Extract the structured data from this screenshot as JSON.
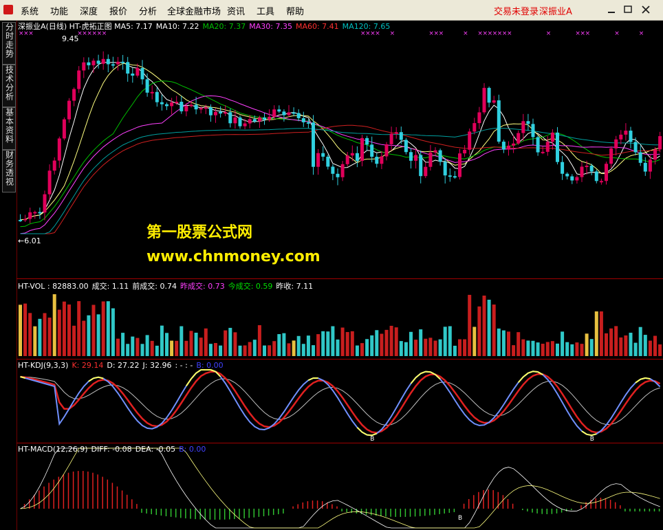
{
  "menu": {
    "items": [
      "系统",
      "功能",
      "深度",
      "报价",
      "分析",
      "全球金融市场",
      "资讯",
      "工具",
      "帮助"
    ],
    "login": "交易未登录",
    "stock": "深振业A"
  },
  "side_tabs": [
    "分时走势",
    "技术分析",
    "基本资料",
    "财务透视"
  ],
  "price_panel": {
    "stock_name": "深振业A",
    "period": "(日线)",
    "indicator": "HT-虎拓正图",
    "ma": [
      {
        "label": "MA5: 7.17",
        "color": "#ffffff"
      },
      {
        "label": "MA10: 7.22",
        "color": "#ffffff"
      },
      {
        "label": "MA20: 7.37",
        "color": "#00c000"
      },
      {
        "label": "MA30: 7.35",
        "color": "#ff40ff"
      },
      {
        "label": "MA60: 7.41",
        "color": "#ff3030"
      },
      {
        "label": "MA120: 7.65",
        "color": "#00c0c0"
      }
    ],
    "high_label": "9.45",
    "low_label": "←6.01"
  },
  "volume_panel": {
    "items": [
      {
        "text": "HT-VOL : 82883.00",
        "color": "#ffffff"
      },
      {
        "text": "成交: 1.11",
        "color": "#ffffff"
      },
      {
        "text": "前成交: 0.74",
        "color": "#ffffff"
      },
      {
        "text": "昨成交: 0.73",
        "color": "#ff40ff"
      },
      {
        "text": "今成交: 0.59",
        "color": "#00e000"
      },
      {
        "text": "昨收: 7.11",
        "color": "#ffffff"
      }
    ]
  },
  "kdj_panel": {
    "items": [
      {
        "text": "HT-KDJ(9,3,3)",
        "color": "#ffffff"
      },
      {
        "text": "K: 29.14",
        "color": "#ff3030"
      },
      {
        "text": "D: 27.22",
        "color": "#ffffff"
      },
      {
        "text": "J: 32.96",
        "color": "#ffffff"
      },
      {
        "text": ": - : -",
        "color": "#ffffff"
      },
      {
        "text": "B: 0.00",
        "color": "#4040ff"
      }
    ],
    "marker": "B"
  },
  "macd_panel": {
    "items": [
      {
        "text": "HT-MACD(12,26,9)",
        "color": "#ffffff"
      },
      {
        "text": "DIFF: -0.08",
        "color": "#ffffff"
      },
      {
        "text": "DEA: -0.05",
        "color": "#ffffff"
      },
      {
        "text": "B: 0.00",
        "color": "#4040ff"
      }
    ],
    "marker": "B"
  },
  "watermark": {
    "title": "第一股票公式网",
    "url": "www.chnmoney.com"
  },
  "colors": {
    "up": "#e0005a",
    "down": "#30d0e0",
    "volume_up": "#c81e1e",
    "volume_down": "#30c8c8",
    "volume_highlight": "#e8c040",
    "ma5": "#ffffff",
    "ma10": "#ffff80",
    "ma20": "#00c000",
    "ma30": "#ff40ff",
    "ma60": "#d02020",
    "ma120": "#00a0a0",
    "cross_marker": "#ff40ff"
  }
}
